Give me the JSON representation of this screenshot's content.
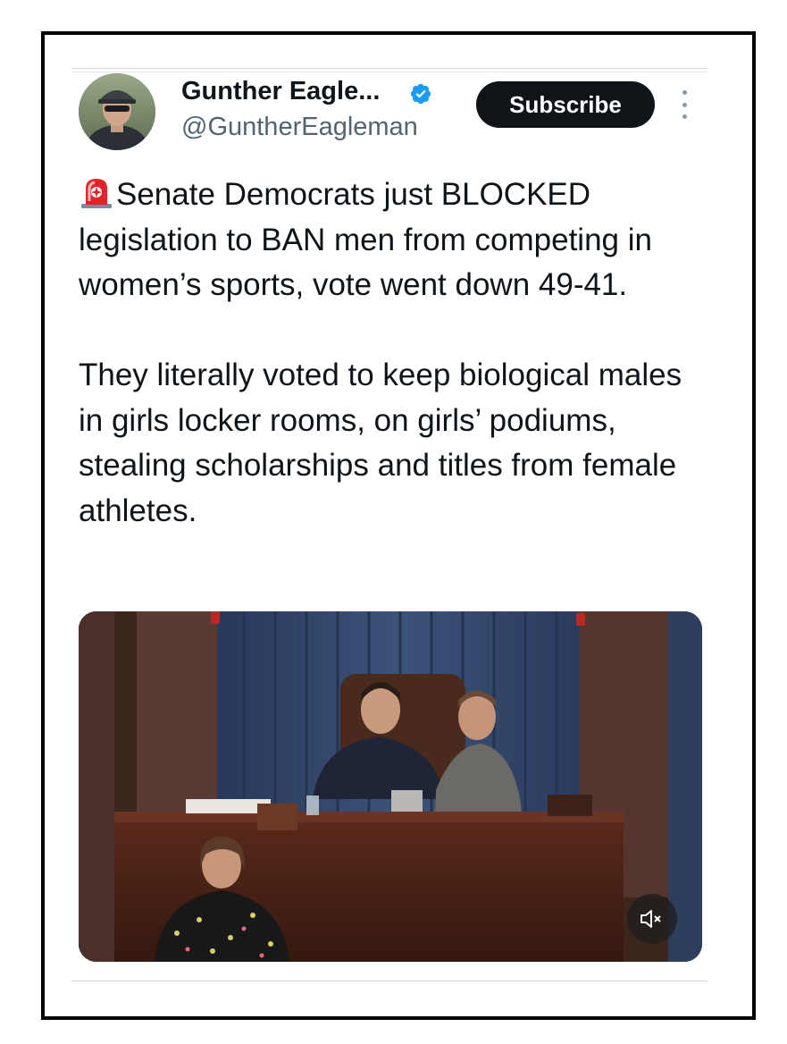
{
  "tweet": {
    "display_name": "Gunther Eagle...",
    "handle": "@GuntherEagleman",
    "verified_icon": "verified-badge-icon",
    "subscribe_label": "Subscribe",
    "more_icon": "more-vertical-icon",
    "emoji_icon": "police-siren-icon",
    "paragraph1": "Senate Democrats just BLOCKED legislation to BAN men from competing in women’s sports, vote went down 49-41.",
    "paragraph2": "They literally voted to keep biological males in girls locker rooms, on girls’ podiums, stealing scholarships and titles from female athletes."
  },
  "media": {
    "kind": "video",
    "mute_icon": "speaker-muted-icon"
  },
  "colors": {
    "frame_border": "#000000",
    "text": "#0f1419",
    "secondary_text": "#536471",
    "verified_blue": "#1d9bf0",
    "button_bg": "#0f1419",
    "button_text": "#ffffff"
  }
}
